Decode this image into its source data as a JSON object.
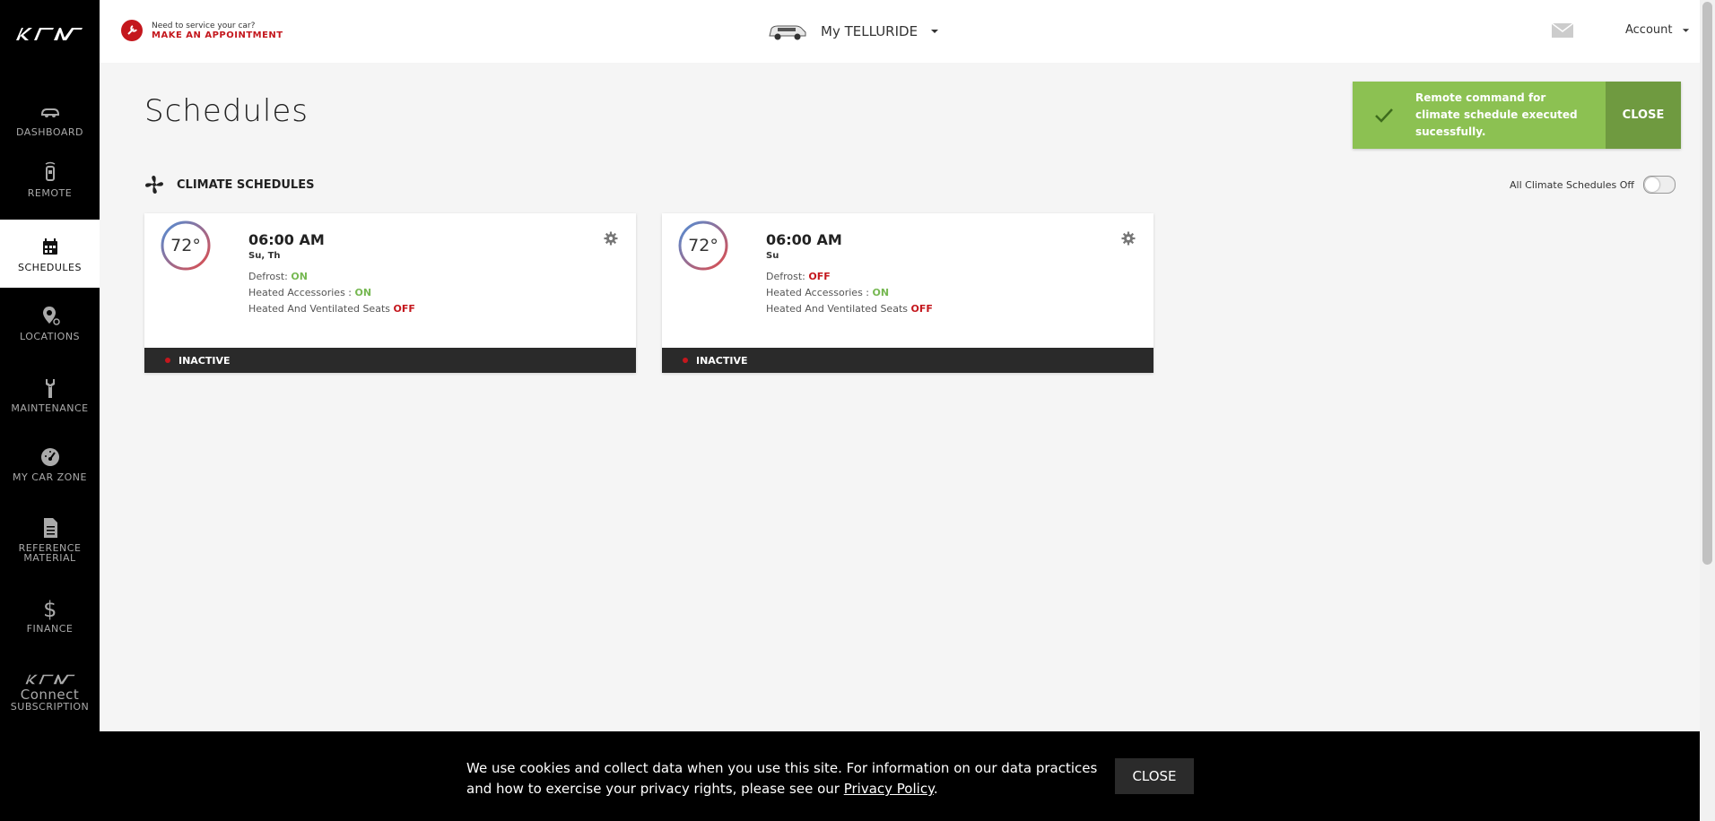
{
  "sidebar": {
    "items": [
      {
        "label": "DASHBOARD",
        "icon": "car-icon"
      },
      {
        "label": "REMOTE",
        "icon": "remote-key-icon"
      },
      {
        "label": "SCHEDULES",
        "icon": "calendar-icon",
        "active": true
      },
      {
        "label": "LOCATIONS",
        "icon": "location-pin-icon"
      },
      {
        "label": "MAINTENANCE",
        "icon": "wrench-icon"
      },
      {
        "label": "MY CAR ZONE",
        "icon": "speedometer-icon"
      },
      {
        "label_line1": "REFERENCE",
        "label_line2": "MATERIAL",
        "icon": "document-icon"
      },
      {
        "label": "FINANCE",
        "icon": "dollar-icon"
      },
      {
        "label_line1": "Connect",
        "label_line2": "SUBSCRIPTION",
        "icon": "kia-logo-icon"
      }
    ]
  },
  "header": {
    "service_prompt": "Need to service your car?",
    "service_link": "MAKE AN APPOINTMENT",
    "vehicle_name": "My TELLURIDE",
    "account_label": "Account"
  },
  "page": {
    "title": "Schedules",
    "section_title": "CLIMATE SCHEDULES",
    "all_off_label": "All Climate Schedules Off"
  },
  "schedules": [
    {
      "temp": "72°",
      "time": "06:00 AM",
      "days": "Su, Th",
      "defrost_label": "Defrost:",
      "defrost": "ON",
      "accessories_label": "Heated Accessories :",
      "accessories": "ON",
      "seats_label": "Heated And Ventilated Seats",
      "seats": "OFF",
      "status": "INACTIVE"
    },
    {
      "temp": "72°",
      "time": "06:00 AM",
      "days": "Su",
      "defrost_label": "Defrost:",
      "defrost": "OFF",
      "accessories_label": "Heated Accessories :",
      "accessories": "ON",
      "seats_label": "Heated And Ventilated Seats",
      "seats": "OFF",
      "status": "INACTIVE"
    }
  ],
  "toast": {
    "message": "Remote command for climate schedule executed sucessfully.",
    "close_label": "CLOSE"
  },
  "cookie": {
    "text": "We use cookies and collect data when you use this site. For information on our data practices and how to exercise your privacy rights, please see our",
    "link": "Privacy Policy",
    "end": ".",
    "close_label": "CLOSE"
  },
  "colors": {
    "accent_red": "#c4171d",
    "on_green": "#76b852",
    "toast_green": "#8cc152",
    "sidebar_bg": "#000000"
  }
}
